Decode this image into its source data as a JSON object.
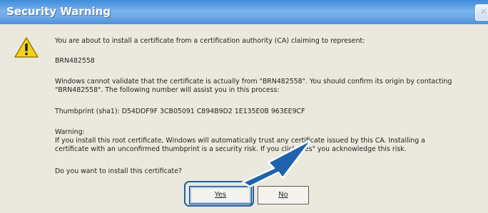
{
  "window": {
    "title": "Security Warning",
    "close_glyph": "×"
  },
  "icons": {
    "warning": "warning-triangle-icon",
    "close": "close-icon",
    "arrow": "pointer-arrow-icon"
  },
  "message": {
    "intro": "You are about to install a certificate from a certification authority (CA) claiming to represent:",
    "ca_name": "BRN482558",
    "validate_line1": "Windows cannot validate that the certificate is actually from \"BRN482558\". You should confirm its origin by contacting",
    "validate_line2": "\"BRN482558\". The following number will assist you in this process:",
    "thumbprint": "Thumbprint (sha1): D54DDF9F 3CB05091 C894B9D2 1E135E0B 963EE9CF",
    "warning_heading": "Warning:",
    "warning_line1": "If you install this root certificate, Windows will automatically trust any certificate issued by this CA. Installing a",
    "warning_line2": "certificate with an unconfirmed thumbprint is a security risk. If you click \"Yes\" you acknowledge this risk.",
    "question": "Do you want to install this certificate?"
  },
  "buttons": {
    "yes": "Yes",
    "no": "No"
  },
  "colors": {
    "titlebar": "#5a9ae0",
    "highlight": "#1f5fa6",
    "arrow": "#1f63ad",
    "dialog_bg": "#ebe9dd"
  }
}
